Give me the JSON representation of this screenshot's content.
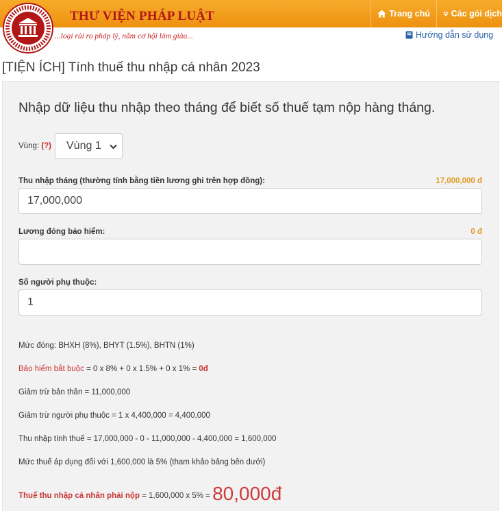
{
  "header": {
    "brand": "THƯ VIỆN PHÁP LUẬT",
    "slogan": "...loại rủi ro pháp lý, nắm cơ hội làm giàu...",
    "nav": [
      "Trang chủ",
      "Các gói dịch"
    ],
    "guide": "Hướng dẫn sử dụng",
    "colors": {
      "bar": "#f0a020",
      "brand_text": "#b21717",
      "link": "#2a61a8"
    }
  },
  "page": {
    "title": "[TIỆN ÍCH] Tính thuế thu nhập cá nhân 2023",
    "lead": "Nhập dữ liệu thu nhập theo tháng để biết số thuế tạm nộp hàng tháng."
  },
  "form": {
    "region_label": "Vùng:",
    "region_help": "(?)",
    "region_value": "Vùng 1",
    "income_label": "Thu nhập tháng (thường tính bằng tiền lương ghi trên hợp đồng):",
    "income_amount": "17,000,000 đ",
    "income_value": "17,000,000",
    "insurance_label": "Lương đóng bảo hiểm:",
    "insurance_amount": "0 đ",
    "insurance_value": "",
    "dependents_label": "Số người phụ thuộc:",
    "dependents_value": "1"
  },
  "results": {
    "rates": "Mức đóng: BHXH (8%), BHYT (1.5%), BHTN (1%)",
    "insurance_label": "Bảo hiểm bắt buộc",
    "insurance_formula": " = 0 x 8% + 0 x 1.5% + 0 x 1% = ",
    "insurance_result": "0đ",
    "self_deduction": "Giảm trừ bản thân = 11,000,000",
    "dependent_deduction": "Giảm trừ người phụ thuộc = 1 x 4,400,000 = 4,400,000",
    "taxable_income": "Thu nhập tính thuế = 17,000,000 - 0 - 11,000,000 - 4,400,000 = 1,600,000",
    "tax_rate": "Mức thuế áp dụng đối với 1,600,000 là 5% (tham khảo bảng bên dưới)",
    "tax_label": "Thuế thu nhập cá nhân phải nộp",
    "tax_formula": " = 1,600,000 x 5% = ",
    "tax_result": "80,000đ"
  }
}
